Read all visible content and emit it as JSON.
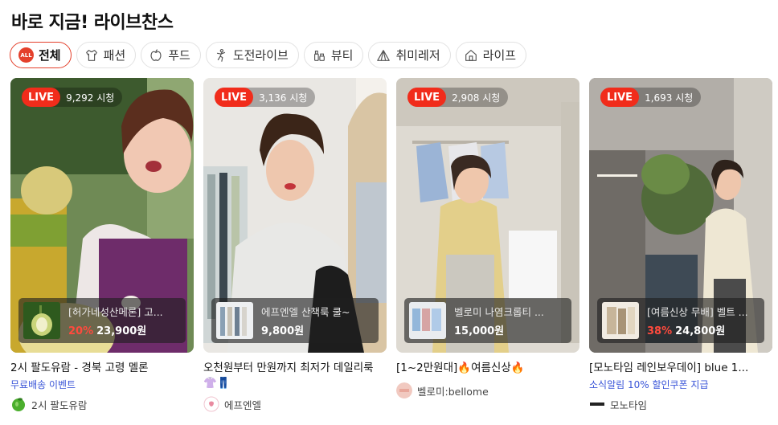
{
  "page_title": "바로 지금! 라이브찬스",
  "tabs": [
    {
      "label": "전체",
      "icon": "all-badge-icon",
      "badge": "ALL",
      "active": true
    },
    {
      "label": "패션",
      "icon": "shirt-icon"
    },
    {
      "label": "푸드",
      "icon": "apple-icon"
    },
    {
      "label": "도전라이브",
      "icon": "dance-icon"
    },
    {
      "label": "뷰티",
      "icon": "cosmetics-icon"
    },
    {
      "label": "취미레저",
      "icon": "tent-icon"
    },
    {
      "label": "라이프",
      "icon": "house-icon"
    }
  ],
  "colors": {
    "accent": "#e4402b",
    "live": "#f12c1b",
    "discount": "#ff4a3d",
    "event_text": "#3a55d8"
  },
  "cards": [
    {
      "live_label": "LIVE",
      "viewers": "9,292 시청",
      "product_name": "[허가네성산메론] 고...",
      "discount": "20%",
      "price": "23,900원",
      "title": "2시 팔도유람 - 경북 고령 멜론",
      "sub": "무료배송 이벤트",
      "seller": "2시 팔도유람",
      "seller_icon": "apple-logo-icon"
    },
    {
      "live_label": "LIVE",
      "viewers": "3,136 시청",
      "product_name": "에프엔엘 산책룩 쿨~",
      "discount": "",
      "price": "9,800원",
      "title": "오천원부터 만원까지 최저가 데일리룩",
      "title_emoji": "👚👖",
      "sub": "",
      "seller": "에프엔엘",
      "seller_icon": "fnl-logo-icon"
    },
    {
      "live_label": "LIVE",
      "viewers": "2,908 시청",
      "product_name": "벨로미 나염크롭티 ...",
      "discount": "",
      "price": "15,000원",
      "title": "[1~2만원대]🔥여름신상🔥",
      "sub": "",
      "seller": "벨로미:bellome",
      "seller_icon": "bellome-logo-icon"
    },
    {
      "live_label": "LIVE",
      "viewers": "1,693 시청",
      "product_name": "[여름신상 무배] 벨트 ...",
      "discount": "38%",
      "price": "24,800원",
      "title": "[모노타임 레인보우데이] blue 1...",
      "sub": "소식알림 10% 할인쿠폰 지급",
      "seller": "모노타임",
      "seller_icon": "monotime-logo-icon"
    }
  ]
}
